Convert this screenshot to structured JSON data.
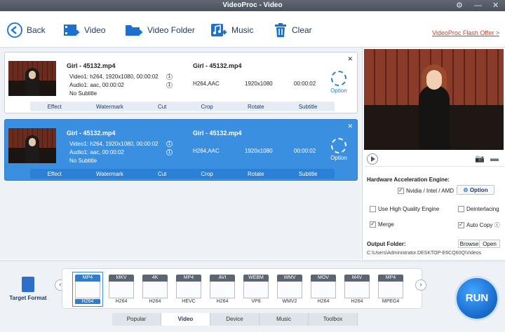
{
  "title": "VideoProc - Video",
  "toolbar": {
    "back": "Back",
    "video": "Video",
    "video_folder": "Video Folder",
    "music": "Music",
    "clear": "Clear",
    "offer": "VideoProc Flash Offer >"
  },
  "files": [
    {
      "name": "Girl - 45132.mp4",
      "video_info": "Video1: h264, 1920x1080, 00:00:02",
      "audio_info": "Audio1: aac, 00:00:02",
      "subtitle": "No Subtitle",
      "video_count": "1",
      "audio_count": "1",
      "output_name": "Girl - 45132.mp4",
      "codec": "H264,AAC",
      "resolution": "1920x1080",
      "duration": "00:00:02",
      "option_label": "Option",
      "actions": [
        "Effect",
        "Watermark",
        "Cut",
        "Crop",
        "Rotate",
        "Subtitle"
      ],
      "selected": false
    },
    {
      "name": "Girl - 45132.mp4",
      "video_info": "Video1: h264, 1920x1080, 00:00:02",
      "audio_info": "Audio1: aac, 00:00:02",
      "subtitle": "No Subtitle",
      "video_count": "1",
      "audio_count": "1",
      "output_name": "Girl - 45132.mp4",
      "codec": "H264,AAC",
      "resolution": "1920x1080",
      "duration": "00:00:02",
      "option_label": "Option",
      "actions": [
        "Effect",
        "Watermark",
        "Cut",
        "Crop",
        "Rotate",
        "Subtitle"
      ],
      "selected": true
    }
  ],
  "settings": {
    "hw_title": "Hardware Acceleration Engine:",
    "hw_vendor": "Nvidia / Intel / AMD",
    "option_button": "Option",
    "high_quality": "Use High Quality Engine",
    "deinterlacing": "Deinterlacing",
    "merge": "Merge",
    "auto_copy": "Auto Copy",
    "output_folder_label": "Output Folder:",
    "browse": "Browse",
    "open": "Open",
    "output_path": "C:\\Users\\Administrator.DESKTOP-E6CQ60Q\\Videos"
  },
  "target_format_label": "Target Format",
  "formats": [
    {
      "badge": "MP4",
      "label": "H264"
    },
    {
      "badge": "MKV",
      "label": "H264"
    },
    {
      "badge": "4K",
      "label": "H264"
    },
    {
      "badge": "MP4",
      "label": "HEVC"
    },
    {
      "badge": "AVI",
      "label": "H264"
    },
    {
      "badge": "WEBM",
      "label": "VP8"
    },
    {
      "badge": "WMV",
      "label": "WMV2"
    },
    {
      "badge": "MOV",
      "label": "H264"
    },
    {
      "badge": "M4V",
      "label": "H264"
    },
    {
      "badge": "MP4",
      "label": "MPEG4"
    }
  ],
  "tabs": [
    "Popular",
    "Video",
    "Device",
    "Music",
    "Toolbox"
  ],
  "run": "RUN"
}
